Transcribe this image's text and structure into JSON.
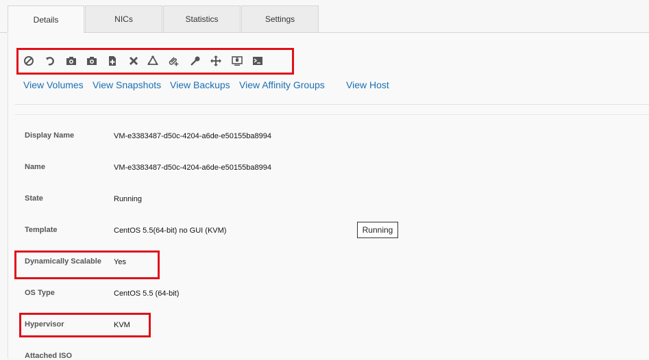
{
  "tabs": [
    {
      "label": "Details",
      "active": true
    },
    {
      "label": "NICs",
      "active": false
    },
    {
      "label": "Statistics",
      "active": false
    },
    {
      "label": "Settings",
      "active": false
    }
  ],
  "toolbar": {
    "actions": [
      {
        "icon": "stop-icon"
      },
      {
        "icon": "reboot-icon"
      },
      {
        "icon": "camera-snapshot-icon"
      },
      {
        "icon": "camera-vm-snapshot-icon"
      },
      {
        "icon": "add-document-icon"
      },
      {
        "icon": "destroy-icon"
      },
      {
        "icon": "recycle-icon"
      },
      {
        "icon": "attach-iso-icon"
      },
      {
        "icon": "key-icon"
      },
      {
        "icon": "migrate-icon"
      },
      {
        "icon": "console-icon"
      },
      {
        "icon": "terminal-icon"
      }
    ]
  },
  "links": [
    {
      "label": "View Volumes"
    },
    {
      "label": "View Snapshots"
    },
    {
      "label": "View Backups"
    },
    {
      "label": "View Affinity Groups"
    },
    {
      "label": "View Host"
    }
  ],
  "details": {
    "display_name": {
      "label": "Display Name",
      "value": "VM-e3383487-d50c-4204-a6de-e50155ba8994"
    },
    "name": {
      "label": "Name",
      "value": "VM-e3383487-d50c-4204-a6de-e50155ba8994"
    },
    "state": {
      "label": "State",
      "value": "Running"
    },
    "template": {
      "label": "Template",
      "value": "CentOS 5.5(64-bit) no GUI (KVM)"
    },
    "dynamically_scalable": {
      "label": "Dynamically Scalable",
      "value": "Yes"
    },
    "os_type": {
      "label": "OS Type",
      "value": "CentOS 5.5 (64-bit)"
    },
    "hypervisor": {
      "label": "Hypervisor",
      "value": "KVM"
    },
    "attached_iso": {
      "label": "Attached ISO",
      "value": ""
    }
  },
  "state_badge": "Running",
  "colors": {
    "link": "#1a6fb3",
    "highlight": "#e0101a",
    "icon": "#555555"
  }
}
